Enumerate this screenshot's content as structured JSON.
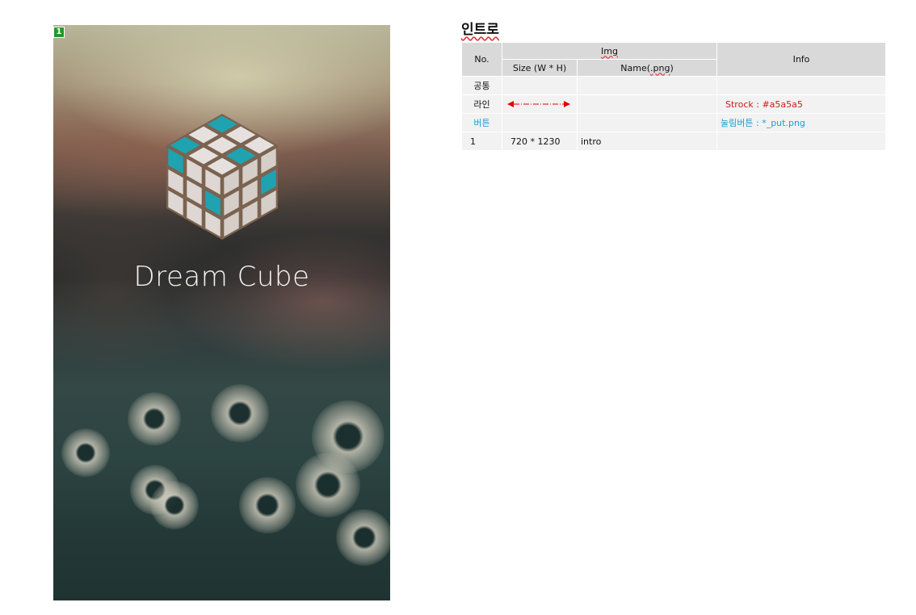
{
  "mockup": {
    "marker_number": "1",
    "brand_text": "Dream Cube",
    "colors": {
      "accent_teal": "#1fa3b0",
      "tile": "#e6e1de",
      "grout": "#7a6350"
    }
  },
  "spec": {
    "title": "인트로",
    "headers": {
      "no": "No.",
      "img": "Img",
      "size": "Size (W * H)",
      "name": "Name(.png)",
      "info": "Info"
    },
    "rows": {
      "common": {
        "no": "공통"
      },
      "line": {
        "no": "라인",
        "info": "Strock : #a5a5a5",
        "arrow_color": "#e00000"
      },
      "button": {
        "no": "버튼",
        "info": "눌림버튼 : *_put.png"
      },
      "intro": {
        "no": "1",
        "size": "720 * 1230",
        "name": "intro"
      }
    }
  }
}
